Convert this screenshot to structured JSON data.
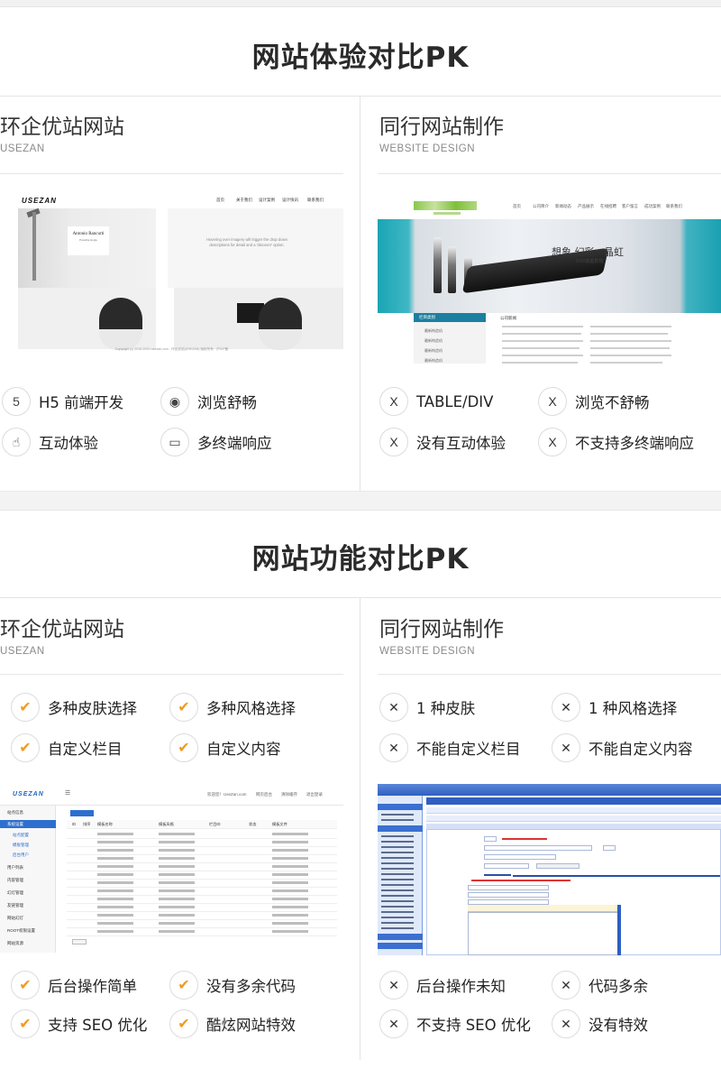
{
  "section1": {
    "title": "网站体验对比PK",
    "left": {
      "title": "环企优站网站",
      "subtitle": "USEZAN",
      "screenshot": {
        "logo": "USEZAN",
        "nav": [
          "首页",
          "关于我们",
          "设计案例",
          "设计快讯",
          "联系我们"
        ],
        "card_name": "Antonio Rancurti",
        "card_sub": "Possible Engle",
        "hero_text": "Hovering over imagery will trigger the drop down descriptions for detail and a 'discover' option.",
        "footer": "Copyright (c) 2018-2020 usezan.com · 环企优站(USEZAN) 版权所有 · 沪ICP备"
      },
      "features": [
        {
          "icon": "html5-icon",
          "glyph": "5",
          "label": "H5 前端开发"
        },
        {
          "icon": "eye-icon",
          "glyph": "◉",
          "label": "浏览舒畅"
        },
        {
          "icon": "hand-pointer-icon",
          "glyph": "☝",
          "label": "互动体验"
        },
        {
          "icon": "monitor-icon",
          "glyph": "▭",
          "label": "多终端响应"
        }
      ]
    },
    "right": {
      "title": "同行网站制作",
      "subtitle": "WEBSITE DESIGN",
      "screenshot": {
        "nav": [
          "首页",
          "公司简介",
          "新闻动态",
          "产品展示",
          "在线招聘",
          "客户留言",
          "成功案例",
          "联系我们"
        ],
        "banner_text": "想象 幻彩 · 晶虹",
        "banner_sub": "DVD家庭影院",
        "side_head": "栏目类别",
        "side_items": [
          "最新构造机",
          "最新构造机",
          "最新构造机",
          "最新构造机"
        ],
        "news_head": "公司新闻"
      },
      "features": [
        {
          "icon": "cross-icon",
          "glyph": "X",
          "label": "TABLE/DIV"
        },
        {
          "icon": "cross-icon",
          "glyph": "X",
          "label": "浏览不舒畅"
        },
        {
          "icon": "cross-icon",
          "glyph": "X",
          "label": "没有互动体验"
        },
        {
          "icon": "cross-icon",
          "glyph": "X",
          "label": "不支持多终端响应"
        }
      ]
    }
  },
  "section2": {
    "title": "网站功能对比PK",
    "left": {
      "title": "环企优站网站",
      "subtitle": "USEZAN",
      "features_top": [
        {
          "icon": "check-icon",
          "glyph": "✔",
          "label": "多种皮肤选择"
        },
        {
          "icon": "check-icon",
          "glyph": "✔",
          "label": "多种风格选择"
        },
        {
          "icon": "check-icon",
          "glyph": "✔",
          "label": "自定义栏目"
        },
        {
          "icon": "check-icon",
          "glyph": "✔",
          "label": "自定义内容"
        }
      ],
      "screenshot": {
        "logo": "USEZAN",
        "top_right": [
          "欢迎您！UseZan.com",
          "网页后台",
          "清除缓存",
          "退出登录"
        ],
        "sidebar": [
          "站点信息",
          "系统设置",
          "站点配置",
          "模板管理",
          "后台用户",
          "用户列表",
          "内容管理",
          "幻灯管理",
          "友链管理",
          "网站幻灯",
          "ROOT权限设置",
          "网站资源"
        ],
        "grid_head": [
          "ID",
          "排序",
          "模板名称",
          "模板风格",
          "栏目ID",
          "状态",
          "模板文件"
        ]
      },
      "features_bottom": [
        {
          "icon": "check-icon",
          "glyph": "✔",
          "label": "后台操作简单"
        },
        {
          "icon": "check-icon",
          "glyph": "✔",
          "label": "没有多余代码"
        },
        {
          "icon": "check-icon",
          "glyph": "✔",
          "label": "支持 SEO 优化"
        },
        {
          "icon": "check-icon",
          "glyph": "✔",
          "label": "酷炫网站特效"
        }
      ]
    },
    "right": {
      "title": "同行网站制作",
      "subtitle": "WEBSITE DESIGN",
      "features_top": [
        {
          "icon": "cross-icon",
          "glyph": "✕",
          "label": "1 种皮肤"
        },
        {
          "icon": "cross-icon",
          "glyph": "✕",
          "label": "1 种风格选择"
        },
        {
          "icon": "cross-icon",
          "glyph": "✕",
          "label": "不能自定义栏目"
        },
        {
          "icon": "cross-icon",
          "glyph": "✕",
          "label": "不能自定义内容"
        }
      ],
      "features_bottom": [
        {
          "icon": "cross-icon",
          "glyph": "✕",
          "label": "后台操作未知"
        },
        {
          "icon": "cross-icon",
          "glyph": "✕",
          "label": "代码多余"
        },
        {
          "icon": "cross-icon",
          "glyph": "✕",
          "label": "不支持 SEO 优化"
        },
        {
          "icon": "cross-icon",
          "glyph": "✕",
          "label": "没有特效"
        }
      ]
    }
  },
  "colors": {
    "check": "#f39a1e",
    "admin_blue": "#2d6fcf",
    "banner_teal": "#1aa5b5"
  }
}
